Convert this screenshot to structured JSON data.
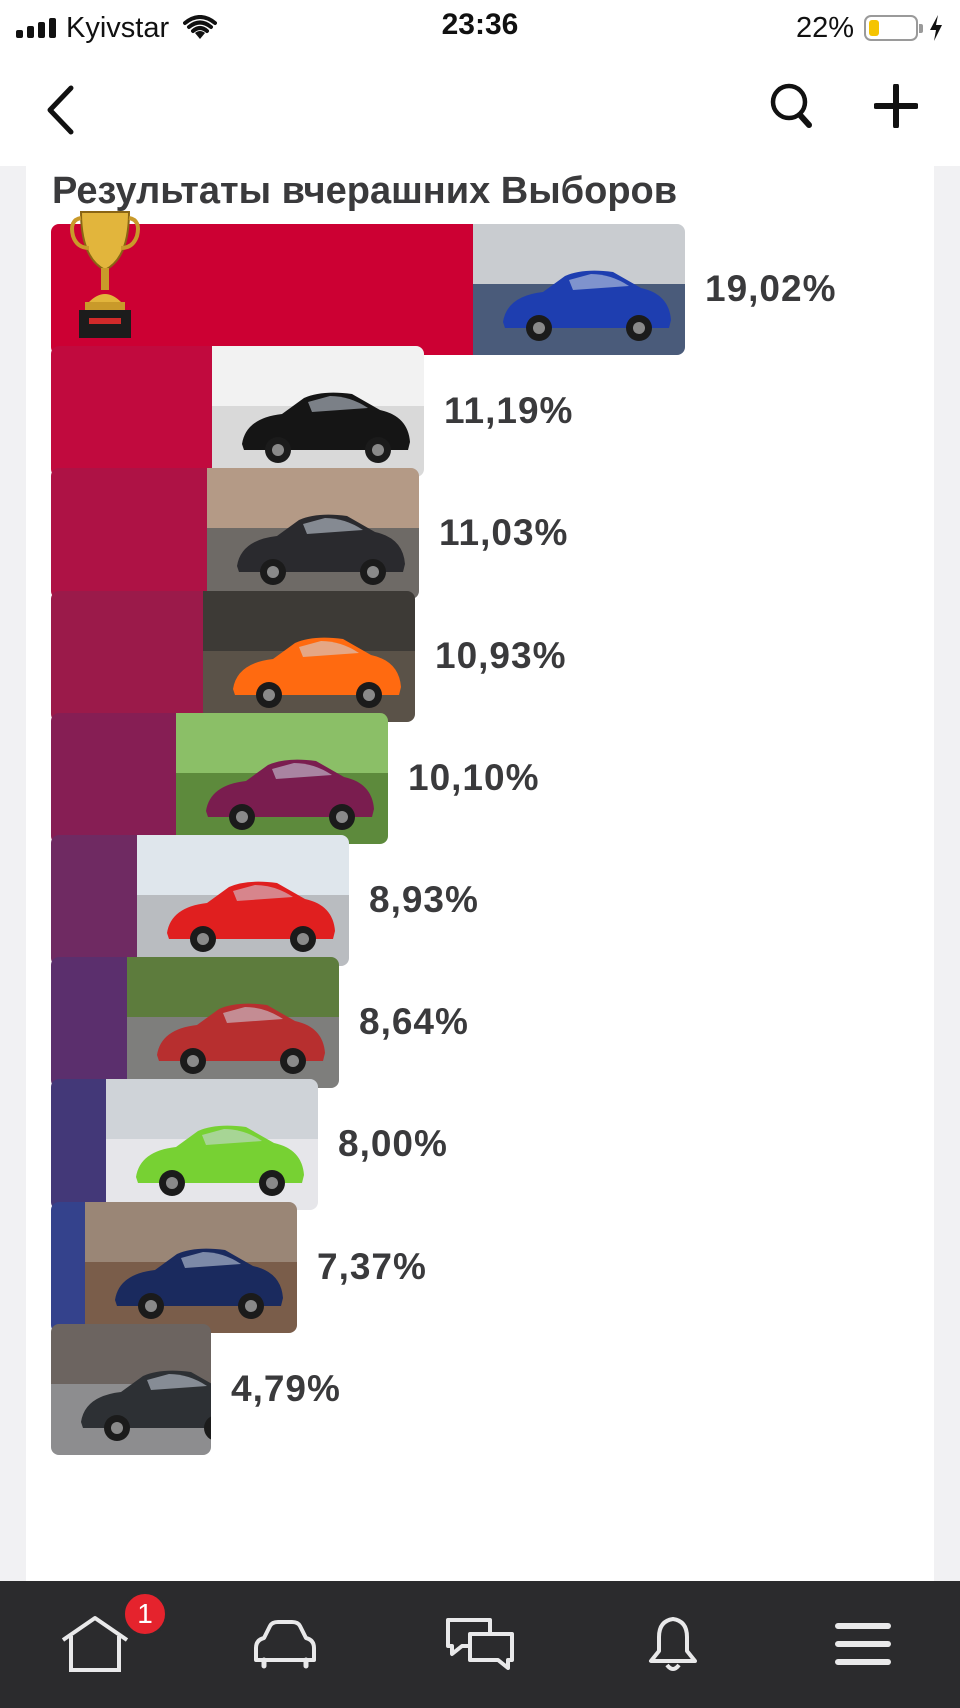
{
  "status_bar": {
    "carrier": "Kyivstar",
    "time": "23:36",
    "battery_percent": "22%",
    "battery_level": 0.22,
    "icons": [
      "signal-icon",
      "wifi-icon",
      "battery-icon",
      "charging-icon"
    ]
  },
  "nav_bar": {
    "icons": [
      "back-chevron-icon",
      "search-icon",
      "plus-icon"
    ]
  },
  "card": {
    "title": "Результаты вчерашних Выборов"
  },
  "chart_data": {
    "type": "bar",
    "orientation": "horizontal",
    "title": "Результаты вчерашних Выборов",
    "values": [
      19.02,
      11.19,
      11.03,
      10.93,
      10.1,
      8.93,
      8.64,
      8.0,
      7.37,
      4.79
    ],
    "value_labels": [
      "19,02%",
      "11,19%",
      "11,03%",
      "10,93%",
      "10,10%",
      "8,93%",
      "8,64%",
      "8,00%",
      "7,37%",
      "4,79%"
    ],
    "colors": [
      "#cc0033",
      "#c10a3e",
      "#ae1245",
      "#9b1a4a",
      "#861e54",
      "#6f2a62",
      "#5b2f6d",
      "#433878",
      "#34428c",
      "#1f5597"
    ],
    "photos": [
      {
        "bg": "#4a5b7a",
        "car": "#1e3eb0",
        "sky": "#c9ccd0"
      },
      {
        "bg": "#d9d9d9",
        "car": "#151515",
        "sky": "#f2f2f2"
      },
      {
        "bg": "#6e6a66",
        "car": "#2a2a2e",
        "sky": "#b49a86"
      },
      {
        "bg": "#5a5248",
        "car": "#ff6a10",
        "sky": "#3d3a36"
      },
      {
        "bg": "#5d8a3c",
        "car": "#7a1d4f",
        "sky": "#8bbf67"
      },
      {
        "bg": "#b9bcc0",
        "car": "#e01f1f",
        "sky": "#dfe6ec"
      },
      {
        "bg": "#7e7e7c",
        "car": "#b72f2f",
        "sky": "#5d7c3d"
      },
      {
        "bg": "#e6e6ea",
        "car": "#77d133",
        "sky": "#cfd3d8"
      },
      {
        "bg": "#7a5d4a",
        "car": "#1a2a5e",
        "sky": "#9a8676"
      },
      {
        "bg": "#8d8d8f",
        "car": "#2d3034",
        "sky": "#6c6460"
      }
    ],
    "winner_marker": "trophy-icon",
    "xlim": [
      0,
      19.02
    ]
  },
  "tab_bar": {
    "home_badge": "1",
    "icons": [
      "home-icon",
      "car-icon",
      "chat-icon",
      "bell-icon",
      "menu-icon"
    ]
  }
}
